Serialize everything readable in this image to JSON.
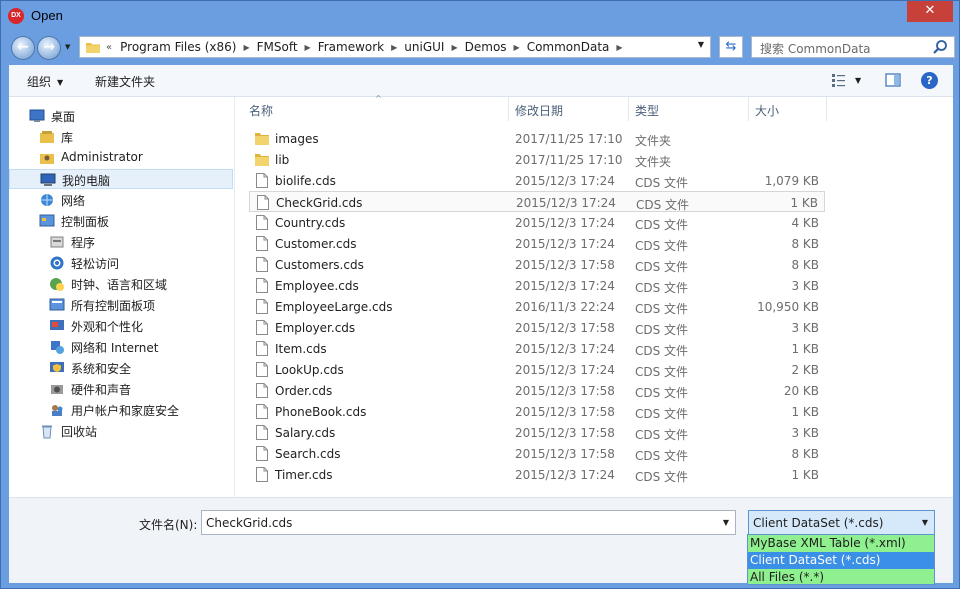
{
  "window": {
    "title": "Open",
    "app_icon_text": "DX",
    "close_glyph": "✕"
  },
  "navbar": {
    "breadcrumb_lead": "«",
    "breadcrumbs": [
      "Program Files (x86)",
      "FMSoft",
      "Framework",
      "uniGUI",
      "Demos",
      "CommonData"
    ],
    "search_placeholder": "搜索 CommonData"
  },
  "toolbar": {
    "organize_label": "组织",
    "new_folder_label": "新建文件夹"
  },
  "sidebar": {
    "items": [
      {
        "label": "桌面",
        "icon": "desktop-icon",
        "level": 0
      },
      {
        "label": "库",
        "icon": "library-icon",
        "level": 1
      },
      {
        "label": "Administrator",
        "icon": "user-folder-icon",
        "level": 1
      },
      {
        "label": "我的电脑",
        "icon": "computer-icon",
        "level": 1,
        "selected": true
      },
      {
        "label": "网络",
        "icon": "network-icon",
        "level": 1
      },
      {
        "label": "控制面板",
        "icon": "control-panel-icon",
        "level": 1
      },
      {
        "label": "程序",
        "icon": "programs-icon",
        "level": 2
      },
      {
        "label": "轻松访问",
        "icon": "ease-of-access-icon",
        "level": 2
      },
      {
        "label": "时钟、语言和区域",
        "icon": "clock-language-icon",
        "level": 2
      },
      {
        "label": "所有控制面板项",
        "icon": "all-control-panel-icon",
        "level": 2
      },
      {
        "label": "外观和个性化",
        "icon": "appearance-icon",
        "level": 2
      },
      {
        "label": "网络和 Internet",
        "icon": "network-internet-icon",
        "level": 2
      },
      {
        "label": "系统和安全",
        "icon": "system-security-icon",
        "level": 2
      },
      {
        "label": "硬件和声音",
        "icon": "hardware-sound-icon",
        "level": 2
      },
      {
        "label": "用户帐户和家庭安全",
        "icon": "user-accounts-icon",
        "level": 2
      },
      {
        "label": "回收站",
        "icon": "recycle-bin-icon",
        "level": 1
      }
    ]
  },
  "columns": {
    "name": "名称",
    "date": "修改日期",
    "type": "类型",
    "size": "大小"
  },
  "files": [
    {
      "name": "images",
      "date": "2017/11/25 17:10",
      "type": "文件夹",
      "size": "",
      "kind": "folder"
    },
    {
      "name": "lib",
      "date": "2017/11/25 17:10",
      "type": "文件夹",
      "size": "",
      "kind": "folder"
    },
    {
      "name": "biolife.cds",
      "date": "2015/12/3 17:24",
      "type": "CDS 文件",
      "size": "1,079 KB",
      "kind": "file"
    },
    {
      "name": "CheckGrid.cds",
      "date": "2015/12/3 17:24",
      "type": "CDS 文件",
      "size": "1 KB",
      "kind": "file",
      "selected": true
    },
    {
      "name": "Country.cds",
      "date": "2015/12/3 17:24",
      "type": "CDS 文件",
      "size": "4 KB",
      "kind": "file"
    },
    {
      "name": "Customer.cds",
      "date": "2015/12/3 17:24",
      "type": "CDS 文件",
      "size": "8 KB",
      "kind": "file"
    },
    {
      "name": "Customers.cds",
      "date": "2015/12/3 17:58",
      "type": "CDS 文件",
      "size": "8 KB",
      "kind": "file"
    },
    {
      "name": "Employee.cds",
      "date": "2015/12/3 17:24",
      "type": "CDS 文件",
      "size": "3 KB",
      "kind": "file"
    },
    {
      "name": "EmployeeLarge.cds",
      "date": "2016/11/3 22:24",
      "type": "CDS 文件",
      "size": "10,950 KB",
      "kind": "file"
    },
    {
      "name": "Employer.cds",
      "date": "2015/12/3 17:58",
      "type": "CDS 文件",
      "size": "3 KB",
      "kind": "file"
    },
    {
      "name": "Item.cds",
      "date": "2015/12/3 17:24",
      "type": "CDS 文件",
      "size": "1 KB",
      "kind": "file"
    },
    {
      "name": "LookUp.cds",
      "date": "2015/12/3 17:24",
      "type": "CDS 文件",
      "size": "2 KB",
      "kind": "file"
    },
    {
      "name": "Order.cds",
      "date": "2015/12/3 17:58",
      "type": "CDS 文件",
      "size": "20 KB",
      "kind": "file"
    },
    {
      "name": "PhoneBook.cds",
      "date": "2015/12/3 17:58",
      "type": "CDS 文件",
      "size": "1 KB",
      "kind": "file"
    },
    {
      "name": "Salary.cds",
      "date": "2015/12/3 17:58",
      "type": "CDS 文件",
      "size": "3 KB",
      "kind": "file"
    },
    {
      "name": "Search.cds",
      "date": "2015/12/3 17:58",
      "type": "CDS 文件",
      "size": "8 KB",
      "kind": "file"
    },
    {
      "name": "Timer.cds",
      "date": "2015/12/3 17:24",
      "type": "CDS 文件",
      "size": "1 KB",
      "kind": "file"
    }
  ],
  "footer": {
    "filename_label": "文件名(N):",
    "filename_value": "CheckGrid.cds",
    "filter_value": "Client DataSet (*.cds)",
    "filter_options": [
      {
        "label": "MyBase XML Table (*.xml)",
        "active": false
      },
      {
        "label": "Client DataSet (*.cds)",
        "active": true
      },
      {
        "label": "All Files (*.*)",
        "active": false
      }
    ]
  },
  "colors": {
    "frame": "#6a9ee0",
    "close": "#c7413a",
    "selection": "#e5f0fb",
    "dropdown_bg": "#8ff08f",
    "dropdown_active": "#3a8fe6"
  }
}
